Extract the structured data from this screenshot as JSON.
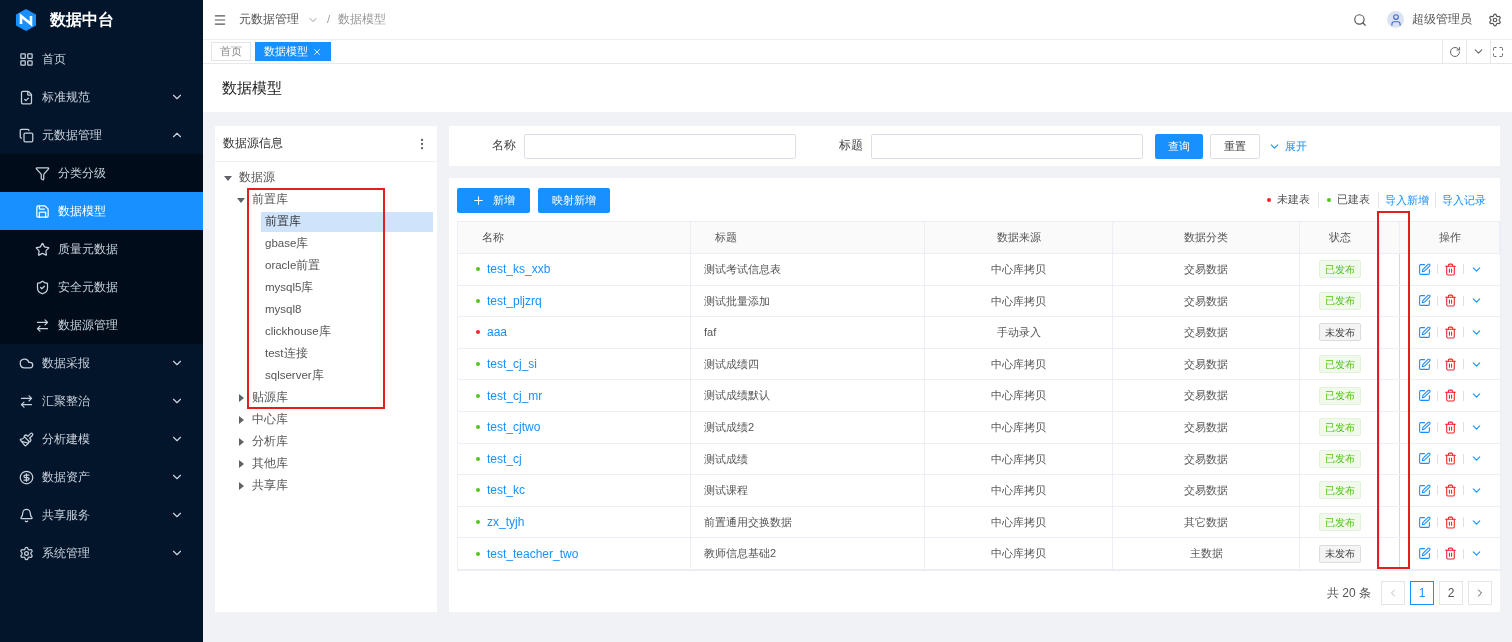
{
  "app": {
    "name": "数据中台"
  },
  "sidebar": {
    "items": [
      {
        "label": "首页",
        "expandable": false,
        "expanded": false,
        "selected": false
      },
      {
        "label": "标准规范",
        "expandable": true,
        "expanded": false,
        "selected": false
      },
      {
        "label": "元数据管理",
        "expandable": true,
        "expanded": true,
        "selected": false,
        "children": [
          {
            "label": "分类分级",
            "selected": false
          },
          {
            "label": "数据模型",
            "selected": true
          },
          {
            "label": "质量元数据",
            "selected": false
          },
          {
            "label": "安全元数据",
            "selected": false
          },
          {
            "label": "数据源管理",
            "selected": false
          }
        ]
      },
      {
        "label": "数据采报",
        "expandable": true,
        "expanded": false,
        "selected": false
      },
      {
        "label": "汇聚整治",
        "expandable": true,
        "expanded": false,
        "selected": false
      },
      {
        "label": "分析建模",
        "expandable": true,
        "expanded": false,
        "selected": false
      },
      {
        "label": "数据资产",
        "expandable": true,
        "expanded": false,
        "selected": false
      },
      {
        "label": "共享服务",
        "expandable": true,
        "expanded": false,
        "selected": false
      },
      {
        "label": "系统管理",
        "expandable": true,
        "expanded": false,
        "selected": false
      }
    ]
  },
  "header": {
    "breadcrumb": [
      "元数据管理",
      "数据模型"
    ],
    "separator": "/",
    "user": "超级管理员"
  },
  "tabs": [
    {
      "label": "首页",
      "selected": false,
      "closable": false
    },
    {
      "label": "数据模型",
      "selected": true,
      "closable": true
    }
  ],
  "page_title": "数据模型",
  "tree": {
    "title": "数据源信息",
    "nodes": [
      {
        "label": "数据源",
        "expanded": true,
        "selected": false,
        "children": [
          {
            "label": "前置库",
            "expanded": true,
            "selected": false,
            "children": [
              {
                "label": "前置库",
                "selected": true
              },
              {
                "label": "gbase库",
                "selected": false
              },
              {
                "label": "oracle前置",
                "selected": false
              },
              {
                "label": "mysql5库",
                "selected": false
              },
              {
                "label": "mysql8",
                "selected": false
              },
              {
                "label": "clickhouse库",
                "selected": false
              },
              {
                "label": "test连接",
                "selected": false
              },
              {
                "label": "sqlserver库",
                "selected": false
              }
            ]
          },
          {
            "label": "贴源库",
            "expanded": false,
            "selected": false
          },
          {
            "label": "中心库",
            "expanded": false,
            "selected": false
          },
          {
            "label": "分析库",
            "expanded": false,
            "selected": false
          },
          {
            "label": "其他库",
            "expanded": false,
            "selected": false
          },
          {
            "label": "共享库",
            "expanded": false,
            "selected": false
          }
        ]
      }
    ]
  },
  "search": {
    "fields": [
      {
        "label": "名称"
      },
      {
        "label": "标题"
      }
    ],
    "query_button": "查询",
    "reset_button": "重置",
    "expand_link": "展开"
  },
  "toolbar": {
    "add_button": "新增",
    "map_add_button": "映射新增",
    "legend": [
      {
        "label": "未建表",
        "color": "#f5222d"
      },
      {
        "label": "已建表",
        "color": "#52c41a"
      }
    ],
    "links": [
      "导入新增",
      "导入记录"
    ]
  },
  "table": {
    "columns": [
      "名称",
      "标题",
      "数据来源",
      "数据分类",
      "状态",
      "",
      "操作"
    ],
    "rows": [
      {
        "name": "test_ks_xxb",
        "color": "#52c41a",
        "title": "测试考试信息表",
        "source": "中心库拷贝",
        "category": "交易数据",
        "status": "已发布",
        "published": true
      },
      {
        "name": "test_pljzrq",
        "color": "#52c41a",
        "title": "测试批量添加",
        "source": "中心库拷贝",
        "category": "交易数据",
        "status": "已发布",
        "published": true
      },
      {
        "name": "aaa",
        "color": "#f5222d",
        "title": "faf",
        "source": "手动录入",
        "category": "交易数据",
        "status": "未发布",
        "published": false
      },
      {
        "name": "test_cj_si",
        "color": "#52c41a",
        "title": "测试成绩四",
        "source": "中心库拷贝",
        "category": "交易数据",
        "status": "已发布",
        "published": true
      },
      {
        "name": "test_cj_mr",
        "color": "#52c41a",
        "title": "测试成绩默认",
        "source": "中心库拷贝",
        "category": "交易数据",
        "status": "已发布",
        "published": true
      },
      {
        "name": "test_cjtwo",
        "color": "#52c41a",
        "title": "测试成绩2",
        "source": "中心库拷贝",
        "category": "交易数据",
        "status": "已发布",
        "published": true
      },
      {
        "name": "test_cj",
        "color": "#52c41a",
        "title": "测试成绩",
        "source": "中心库拷贝",
        "category": "交易数据",
        "status": "已发布",
        "published": true
      },
      {
        "name": "test_kc",
        "color": "#52c41a",
        "title": "测试课程",
        "source": "中心库拷贝",
        "category": "交易数据",
        "status": "已发布",
        "published": true
      },
      {
        "name": "zx_tyjh",
        "color": "#52c41a",
        "title": "前置通用交换数据",
        "source": "中心库拷贝",
        "category": "其它数据",
        "status": "已发布",
        "published": true
      },
      {
        "name": "test_teacher_two",
        "color": "#52c41a",
        "title": "教师信息基础2",
        "source": "中心库拷贝",
        "category": "主数据",
        "status": "未发布",
        "published": false
      }
    ]
  },
  "pagination": {
    "total": "共 20 条",
    "pages": [
      {
        "label": "1",
        "selected": true
      },
      {
        "label": "2",
        "selected": false
      }
    ]
  },
  "annotation_frames": {
    "tree": true,
    "table_gap_column": true
  }
}
